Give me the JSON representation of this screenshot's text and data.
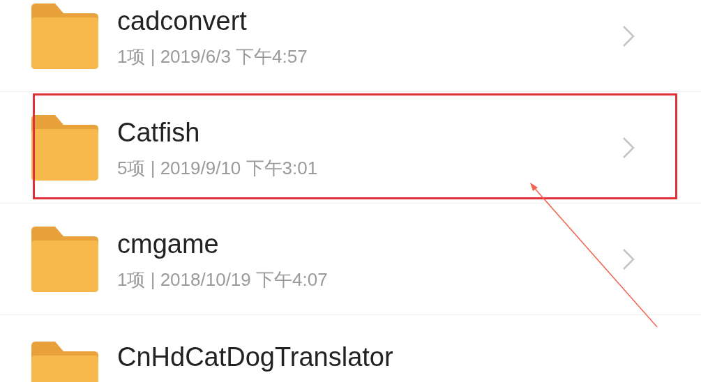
{
  "folders": [
    {
      "name": "cadconvert",
      "meta": "1项 | 2019/6/3 下午4:57",
      "highlighted": false
    },
    {
      "name": "Catfish",
      "meta": "5项 | 2019/9/10 下午3:01",
      "highlighted": true
    },
    {
      "name": "cmgame",
      "meta": "1项 | 2018/10/19 下午4:07",
      "highlighted": false
    },
    {
      "name": "CnHdCatDogTranslator",
      "highlighted": false
    }
  ]
}
